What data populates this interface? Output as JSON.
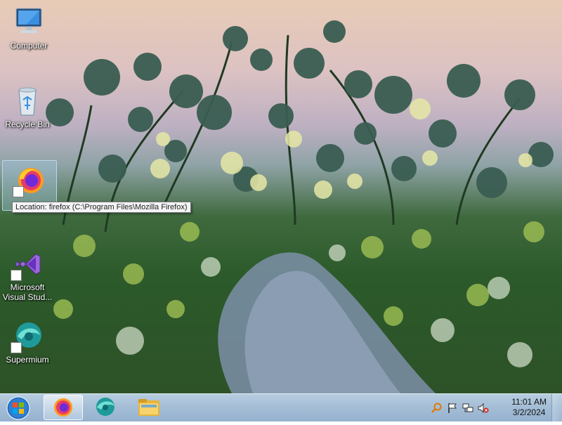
{
  "desktop": {
    "icons": [
      {
        "label": "Computer",
        "icon": "computer-icon"
      },
      {
        "label": "Recycle Bin",
        "icon": "recycle-bin-icon"
      },
      {
        "label": "",
        "icon": "firefox-icon"
      },
      {
        "label": "Microsoft Visual Stud...",
        "icon": "visual-studio-icon"
      },
      {
        "label": "Supermium",
        "icon": "supermium-icon"
      }
    ],
    "tooltip": "Location: firefox (C:\\Program Files\\Mozilla Firefox)"
  },
  "taskbar": {
    "start": "start-orb-icon",
    "pinned": [
      {
        "icon": "firefox-icon",
        "active": true
      },
      {
        "icon": "supermium-icon",
        "active": false
      },
      {
        "icon": "file-explorer-icon",
        "active": false
      }
    ],
    "tray": {
      "icons": [
        "search-icon",
        "action-center-flag-icon",
        "network-icon",
        "volume-muted-icon"
      ],
      "time": "11:01 AM",
      "date": "3/2/2024"
    }
  },
  "colors": {
    "taskbar": "#a5bed6",
    "accent": "#1f6fd1"
  }
}
